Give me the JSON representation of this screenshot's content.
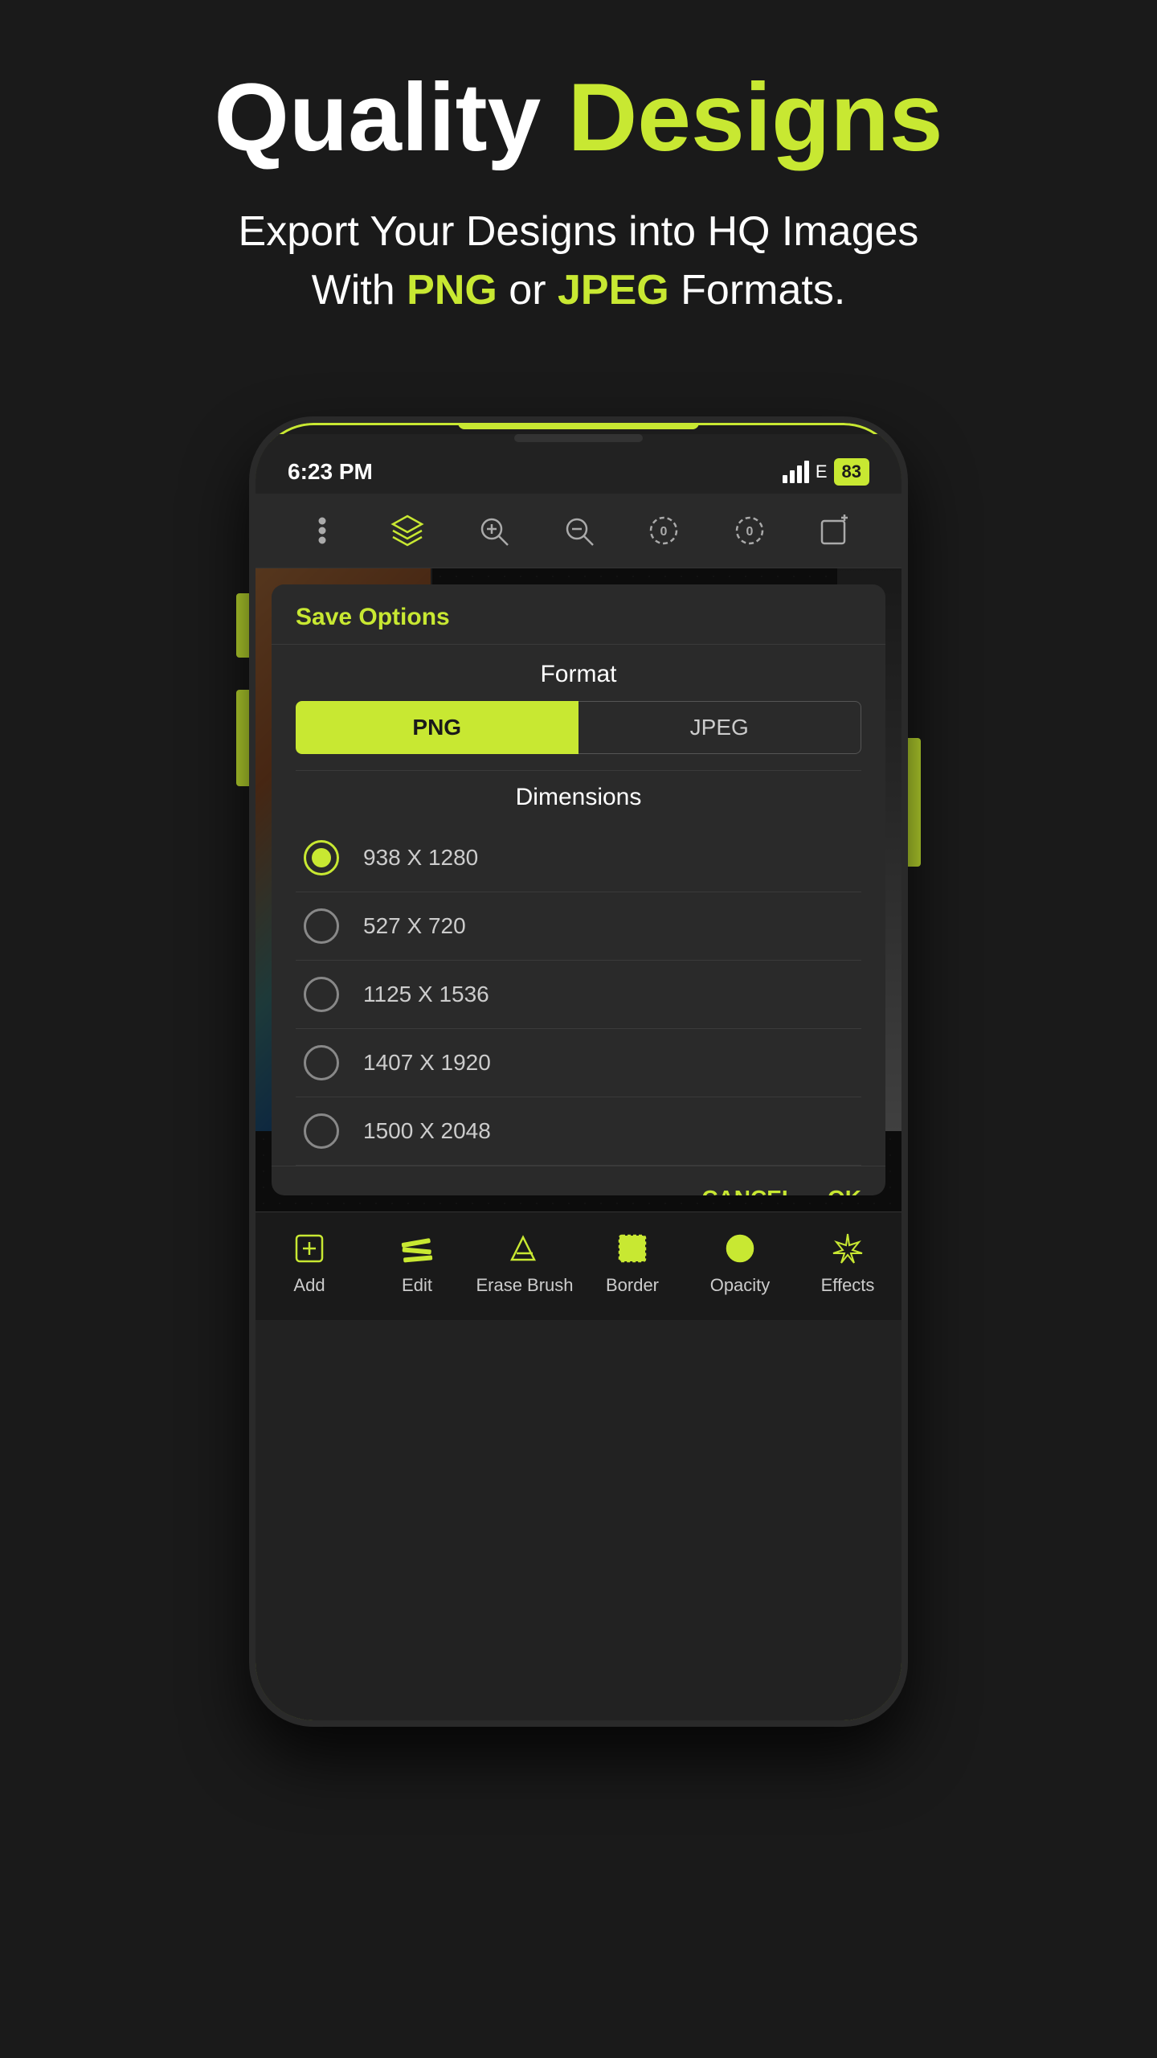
{
  "header": {
    "title_part1": "Quality ",
    "title_part2": "Designs",
    "subtitle_line1": "Export Your Designs into HQ Images",
    "subtitle_line2_pre": "With ",
    "subtitle_png": "PNG",
    "subtitle_mid": " or ",
    "subtitle_jpeg": "JPEG",
    "subtitle_post": " Formats."
  },
  "phone": {
    "status_bar": {
      "time": "6:23 PM",
      "network": "E",
      "battery": "83"
    },
    "toolbar": {
      "icons": [
        "menu",
        "layers",
        "zoom-in",
        "zoom-out",
        "crop-circle-0",
        "crop-circle-1",
        "add-layer"
      ]
    },
    "dialog": {
      "title": "Save Options",
      "format_label": "Format",
      "format_png": "PNG",
      "format_jpeg": "JPEG",
      "dimensions_label": "Dimensions",
      "options": [
        {
          "value": "938 X 1280",
          "selected": true
        },
        {
          "value": "527 X 720",
          "selected": false
        },
        {
          "value": "1125 X 1536",
          "selected": false
        },
        {
          "value": "1407 X 1920",
          "selected": false
        },
        {
          "value": "1500 X 2048",
          "selected": false
        }
      ],
      "cancel": "CANCEL",
      "ok": "OK"
    },
    "bottom_nav": {
      "items": [
        {
          "icon": "add",
          "label": "Add"
        },
        {
          "icon": "edit",
          "label": "Edit"
        },
        {
          "icon": "erase",
          "label": "Erase Brush"
        },
        {
          "icon": "border",
          "label": "Border"
        },
        {
          "icon": "opacity",
          "label": "Opacity"
        },
        {
          "icon": "effects",
          "label": "Effects"
        }
      ]
    }
  }
}
